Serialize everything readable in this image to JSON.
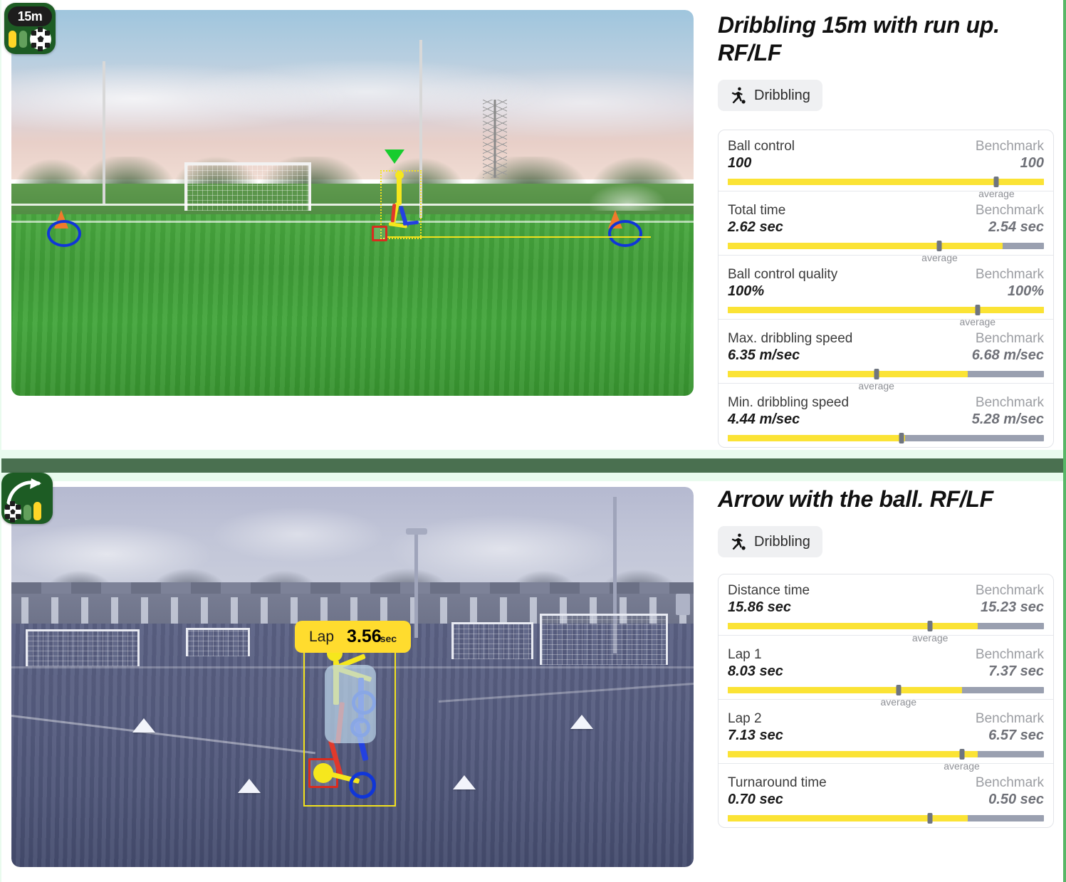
{
  "page": {
    "background_color": "#ffffff",
    "accent_green": "#4a7050",
    "bar_fill_color": "#fbe335",
    "bar_track_color": "#9aa0b0",
    "badge_color": "#1d5c24"
  },
  "sections": [
    {
      "id": "dribbling-15m",
      "title": "Dribbling 15m with run up. RF/LF",
      "tag": {
        "label": "Dribbling",
        "icon": "running-player-with-ball-icon"
      },
      "badge": {
        "distance_label": "15m",
        "icons": [
          "foot-yellow-icon",
          "foot-green-icon",
          "soccer-ball-icon"
        ]
      },
      "video": {
        "overlay_labels": []
      },
      "metrics": [
        {
          "name": "Ball control",
          "value": "100",
          "benchmark_label": "Benchmark",
          "benchmark_value": "100",
          "fill_percent": 100,
          "marker_percent": 85,
          "caption": "average"
        },
        {
          "name": "Total time",
          "value": "2.62 sec",
          "benchmark_label": "Benchmark",
          "benchmark_value": "2.54 sec",
          "fill_percent": 87,
          "marker_percent": 67,
          "caption": "average"
        },
        {
          "name": "Ball control quality",
          "value": "100%",
          "benchmark_label": "Benchmark",
          "benchmark_value": "100%",
          "fill_percent": 100,
          "marker_percent": 79,
          "caption": "average"
        },
        {
          "name": "Max. dribbling speed",
          "value": "6.35 m/sec",
          "benchmark_label": "Benchmark",
          "benchmark_value": "6.68 m/sec",
          "fill_percent": 76,
          "marker_percent": 47,
          "caption": "average"
        },
        {
          "name": "Min. dribbling speed",
          "value": "4.44 m/sec",
          "benchmark_label": "Benchmark",
          "benchmark_value": "5.28 m/sec",
          "fill_percent": 56,
          "marker_percent": 55,
          "caption": "average"
        }
      ]
    },
    {
      "id": "arrow-with-ball",
      "title": "Arrow with the ball. RF/LF",
      "tag": {
        "label": "Dribbling",
        "icon": "running-player-with-ball-icon"
      },
      "badge": {
        "distance_label": "",
        "icons": [
          "curved-arrow-icon",
          "soccer-ball-icon",
          "foot-green-icon",
          "foot-yellow-icon"
        ]
      },
      "video": {
        "lap_overlay": {
          "label": "Lap",
          "value": "3.56",
          "unit": "sec"
        }
      },
      "metrics": [
        {
          "name": "Distance time",
          "value": "15.86 sec",
          "benchmark_label": "Benchmark",
          "benchmark_value": "15.23 sec",
          "fill_percent": 79,
          "marker_percent": 64,
          "caption": "average"
        },
        {
          "name": "Lap 1",
          "value": "8.03 sec",
          "benchmark_label": "Benchmark",
          "benchmark_value": "7.37 sec",
          "fill_percent": 74,
          "marker_percent": 54,
          "caption": "average"
        },
        {
          "name": "Lap 2",
          "value": "7.13 sec",
          "benchmark_label": "Benchmark",
          "benchmark_value": "6.57 sec",
          "fill_percent": 79,
          "marker_percent": 74,
          "caption": "average"
        },
        {
          "name": "Turnaround time",
          "value": "0.70 sec",
          "benchmark_label": "Benchmark",
          "benchmark_value": "0.50 sec",
          "fill_percent": 76,
          "marker_percent": 64,
          "caption": "average"
        }
      ]
    }
  ]
}
